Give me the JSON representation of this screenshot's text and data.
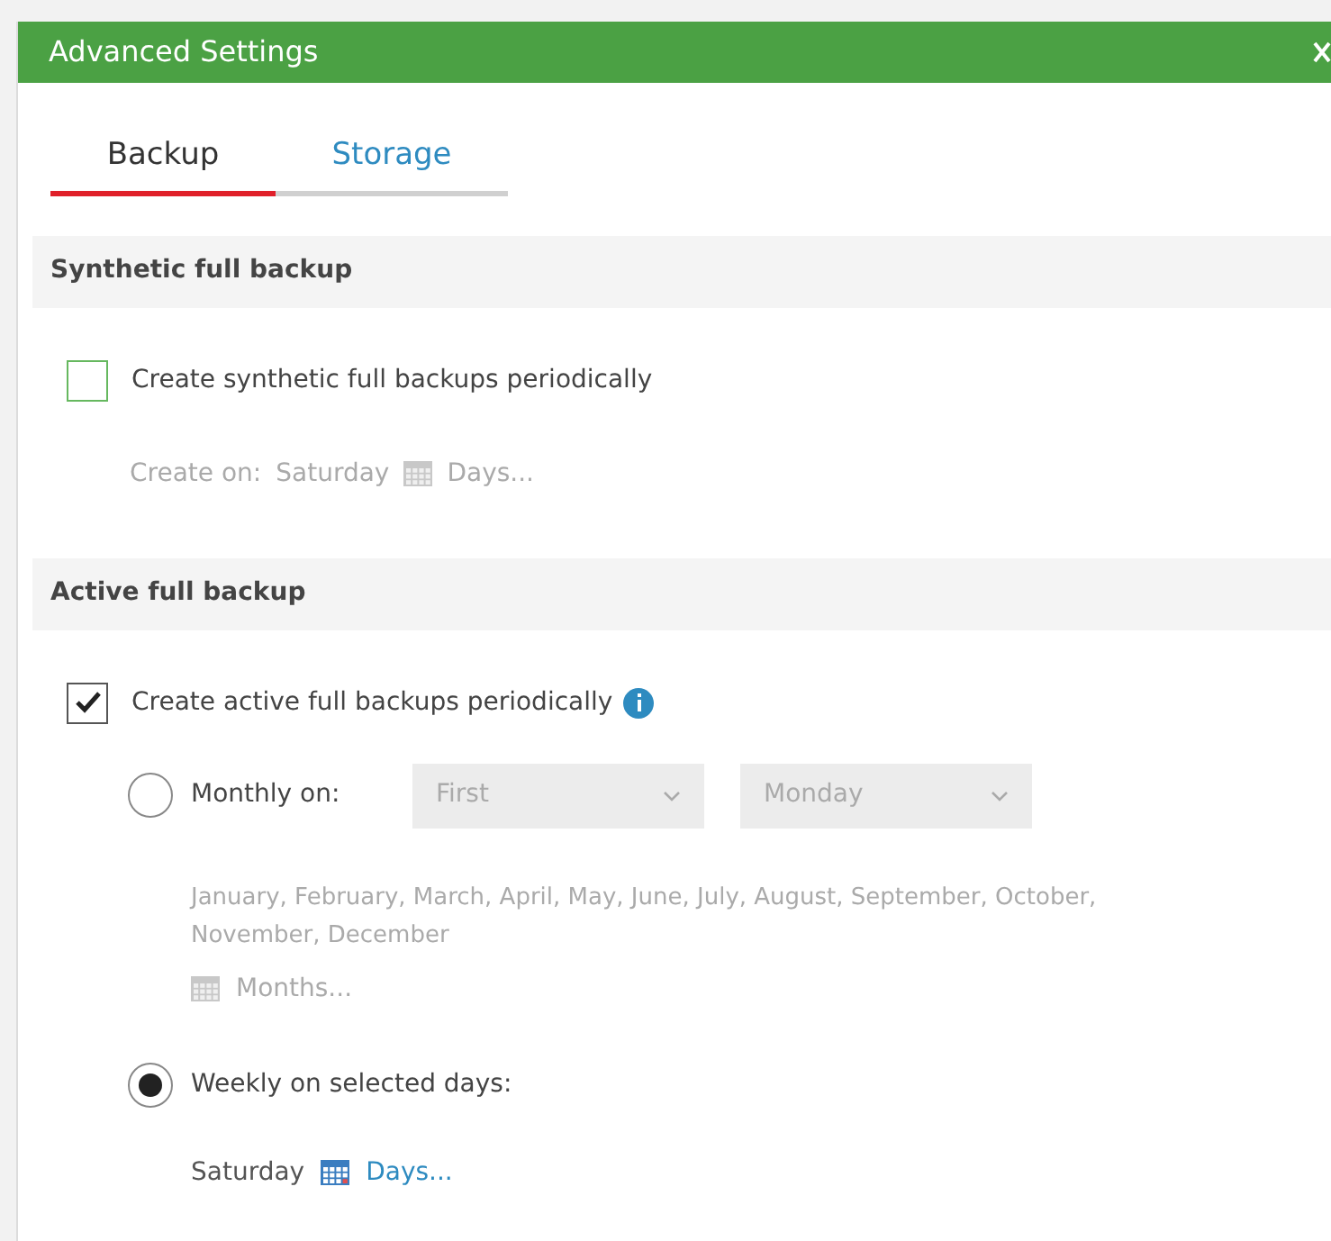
{
  "window": {
    "title": "Advanced Settings"
  },
  "tabs": [
    {
      "label": "Backup",
      "selected": true
    },
    {
      "label": "Storage",
      "selected": false
    }
  ],
  "sections": [
    {
      "title": "Synthetic full backup",
      "checkbox": {
        "label": "Create synthetic full backups periodically",
        "checked": false,
        "info": false
      },
      "schedule": {
        "label": "Create on:",
        "day": "Saturday",
        "link": "Days..."
      }
    },
    {
      "title": "Active full backup",
      "checkbox": {
        "label": "Create active full backups periodically",
        "checked": true,
        "info": true
      },
      "options": [
        {
          "kind": "monthly",
          "label": "Monthly on:",
          "selected": false,
          "dropdowns": [
            "First",
            "Monday"
          ],
          "months": "January, February, March, April, May, June, July, August, September, October, November, December",
          "link": "Months..."
        },
        {
          "kind": "weekly",
          "label": "Weekly on selected days:",
          "selected": true,
          "day": "Saturday",
          "link": "Days..."
        }
      ]
    }
  ]
}
